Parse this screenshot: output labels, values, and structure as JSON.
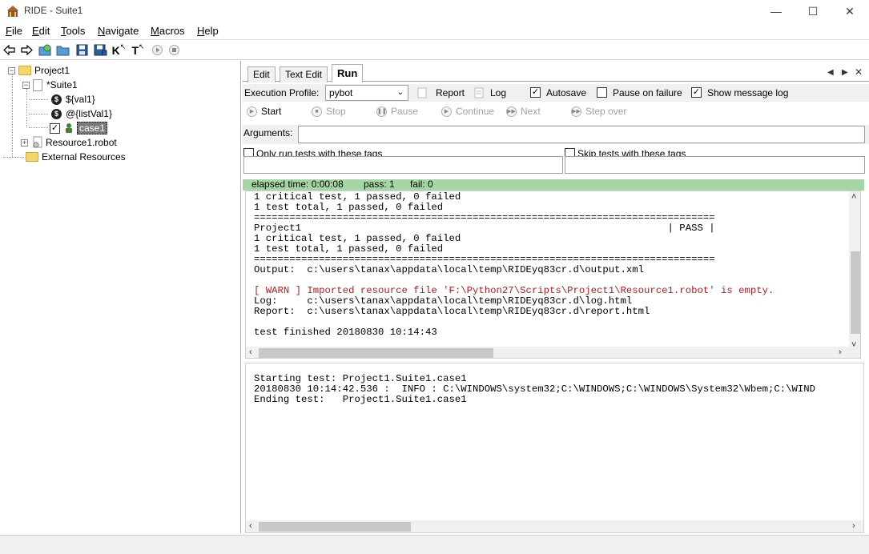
{
  "window": {
    "title": "RIDE - Suite1",
    "minimize": "—",
    "maximize": "☐",
    "close": "✕"
  },
  "menu": {
    "items": [
      {
        "key": "F",
        "rest": "ile"
      },
      {
        "key": "E",
        "rest": "dit"
      },
      {
        "key": "T",
        "rest": "ools"
      },
      {
        "key": "N",
        "rest": "avigate"
      },
      {
        "key": "M",
        "rest": "acros"
      },
      {
        "key": "H",
        "rest": "elp"
      }
    ]
  },
  "toolbar": {
    "icons": [
      "back-arrow-icon",
      "forward-arrow-icon",
      "open-suite-icon",
      "open-directory-icon",
      "save-icon",
      "save-all-icon",
      "search-keywords-icon",
      "search-tests-icon",
      "run-icon",
      "stop-icon"
    ],
    "k_glyph": "K",
    "t_glyph": "T"
  },
  "tree": {
    "project": "Project1",
    "suite": "*Suite1",
    "var1": "${val1}",
    "var2": "@{listVal1}",
    "var_glyph": "$",
    "test": "case1",
    "resource": "Resource1.robot",
    "external": "External Resources",
    "collapse": "−",
    "expand": "+",
    "check": "✓"
  },
  "tabs": {
    "edit": "Edit",
    "text_edit": "Text Edit",
    "run": "Run",
    "nav_prev": "◀",
    "nav_next": "▶",
    "nav_close": "✕"
  },
  "run": {
    "execution_profile_label": "Execution Profile:",
    "profile_value": "pybot",
    "select_arrow": "⌄",
    "report_label": "Report",
    "log_label": "Log",
    "autosave_label": "Autosave",
    "autosave_checked": true,
    "pause_on_failure_label": "Pause on failure",
    "pause_on_failure_checked": false,
    "show_message_log_label": "Show message log",
    "show_message_log_checked": true,
    "check_glyph": "✓",
    "controls": {
      "start": "Start",
      "stop": "Stop",
      "pause": "Pause",
      "continue": "Continue",
      "next": "Next",
      "step_over": "Step over"
    },
    "arguments_label": "Arguments:",
    "arguments_value": "",
    "only_run_tags_label": "Only run tests with these tags",
    "skip_tags_label": "Skip tests with these tags",
    "status": {
      "elapsed": "elapsed time: 0:00:08",
      "pass": "pass: 1",
      "fail": "fail: 0"
    },
    "console_lines_before_warn": "1 critical test, 1 passed, 0 failed\n1 test total, 1 passed, 0 failed\n==============================================================================\nProject1                                                              | PASS |\n1 critical test, 1 passed, 0 failed\n1 test total, 1 passed, 0 failed\n==============================================================================\nOutput:  c:\\users\\tanax\\appdata\\local\\temp\\RIDEyq83cr.d\\output.xml\n",
    "console_warn": "[ WARN ] Imported resource file 'F:\\Python27\\Scripts\\Project1\\Resource1.robot' is empty.",
    "console_lines_after_warn": "Log:     c:\\users\\tanax\\appdata\\local\\temp\\RIDEyq83cr.d\\log.html\nReport:  c:\\users\\tanax\\appdata\\local\\temp\\RIDEyq83cr.d\\report.html\n\ntest finished 20180830 10:14:43",
    "message_log": "Starting test: Project1.Suite1.case1\n20180830 10:14:42.536 :  INFO : C:\\WINDOWS\\system32;C:\\WINDOWS;C:\\WINDOWS\\System32\\Wbem;C:\\WIND\nEnding test:   Project1.Suite1.case1",
    "scroll_left": "‹",
    "scroll_right": "›",
    "scroll_up": "˄",
    "scroll_down": "˅"
  },
  "colors": {
    "status_green": "#a6d6a6",
    "warn_red": "#b02020",
    "folder_yellow": "#f4d66b"
  }
}
